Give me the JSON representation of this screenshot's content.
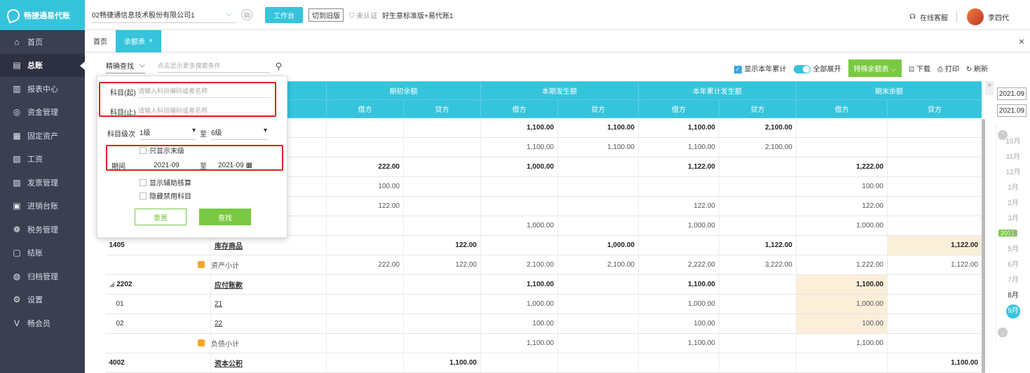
{
  "app": {
    "name": "畅捷通易代账"
  },
  "sidebar": {
    "items": [
      {
        "label": "首页",
        "icon": "home-icon",
        "glyph": "⌂"
      },
      {
        "label": "总账",
        "icon": "ledger-icon",
        "glyph": "▤",
        "active": true
      },
      {
        "label": "报表中心",
        "icon": "report-icon",
        "glyph": "▥"
      },
      {
        "label": "资金管理",
        "icon": "fund-icon",
        "glyph": "◎"
      },
      {
        "label": "固定资产",
        "icon": "asset-icon",
        "glyph": "▦"
      },
      {
        "label": "工资",
        "icon": "salary-icon",
        "glyph": "▧"
      },
      {
        "label": "发票管理",
        "icon": "invoice-icon",
        "glyph": "▨"
      },
      {
        "label": "进销台账",
        "icon": "inventory-icon",
        "glyph": "▣"
      },
      {
        "label": "税务管理",
        "icon": "tax-icon",
        "glyph": "❁"
      },
      {
        "label": "结账",
        "icon": "close-account-icon",
        "glyph": "▢"
      },
      {
        "label": "归档管理",
        "icon": "archive-icon",
        "glyph": "◍"
      },
      {
        "label": "设置",
        "icon": "settings-icon",
        "glyph": "⚙"
      },
      {
        "label": "畅会员",
        "icon": "vip-icon",
        "glyph": "V"
      }
    ]
  },
  "topbar": {
    "company": "02畅捷通信息技术股份有限公司1",
    "workbench": "工作台",
    "switch_version": "切到旧版",
    "cert": "未认证",
    "edition": "好生意标准版+易代账1",
    "service": "在线客服",
    "user": "李四代"
  },
  "tabs": [
    {
      "label": "首页"
    },
    {
      "label": "余额表",
      "active": true
    }
  ],
  "toolbar": {
    "search_mode": "精确查找",
    "search_more": "点击显示更多搜索条件",
    "show_year": "显示本年累计",
    "expand_all": "全部展开",
    "special_balance": "特殊余额表",
    "download": "下载",
    "print": "打印",
    "refresh": "刷新"
  },
  "search": {
    "from_label": "科目(起)",
    "to_label": "科目(止)",
    "placeholder": "请输入科目编码或者名称",
    "level_label": "科目级次",
    "level_from": "1级",
    "level_to_sep": "至",
    "level_to": "6级",
    "only_last": "只显示末级",
    "period_label": "期间",
    "period_from": "2021-09",
    "period_sep": "至",
    "period_to": "2021-09",
    "show_aux": "显示辅助核算",
    "hide_disabled": "隐藏禁用科目",
    "reset": "重置",
    "find": "查找"
  },
  "table": {
    "group_headers": [
      "期初余额",
      "本期发生额",
      "本年累计发生额",
      "期末余额"
    ],
    "sub_headers": [
      "借方",
      "贷方",
      "借方",
      "贷方",
      "借方",
      "贷方",
      "借方",
      "贷方"
    ],
    "rows": [
      {
        "code": "",
        "name": "",
        "bold": true,
        "vals": [
          "",
          "",
          "1,100.00",
          "1,100.00",
          "1,100.00",
          "2,100.00",
          "",
          ""
        ]
      },
      {
        "code": "",
        "name": "",
        "vals": [
          "",
          "",
          "1,100.00",
          "1,100.00",
          "1,100.00",
          "2,100.00",
          "",
          ""
        ]
      },
      {
        "code": "",
        "name": "",
        "bold": true,
        "vals": [
          "222.00",
          "",
          "1,000.00",
          "",
          "1,122.00",
          "",
          "1,222.00",
          ""
        ]
      },
      {
        "code": "",
        "name": "",
        "vals": [
          "100.00",
          "",
          "",
          "",
          "",
          "",
          "100.00",
          ""
        ]
      },
      {
        "code": "",
        "name": "",
        "vals": [
          "122.00",
          "",
          "",
          "",
          "122.00",
          "",
          "122.00",
          ""
        ]
      },
      {
        "code": "",
        "name": "",
        "vals": [
          "",
          "",
          "1,000.00",
          "",
          "1,000.00",
          "",
          "1,000.00",
          ""
        ]
      },
      {
        "code": "1405",
        "name": "库存商品",
        "bold": true,
        "vals": [
          "",
          "122.00",
          "",
          "1,000.00",
          "",
          "1,122.00",
          "",
          "1,122.00"
        ],
        "hl": [
          7
        ]
      },
      {
        "code": "",
        "name": "资产小计",
        "subtotal": true,
        "vals": [
          "222.00",
          "122.00",
          "2,100.00",
          "2,100.00",
          "2,222.00",
          "3,222.00",
          "1,222.00",
          "1,122.00"
        ]
      },
      {
        "code": "2202",
        "name": "应付账款",
        "bold": true,
        "expand": true,
        "vals": [
          "",
          "",
          "1,100.00",
          "",
          "1,100.00",
          "",
          "1,100.00",
          ""
        ],
        "hl": [
          6
        ]
      },
      {
        "code": "01",
        "name": "21",
        "link": true,
        "vals": [
          "",
          "",
          "1,000.00",
          "",
          "1,000.00",
          "",
          "1,000.00",
          ""
        ],
        "hl": [
          6
        ]
      },
      {
        "code": "02",
        "name": "22",
        "link": true,
        "vals": [
          "",
          "",
          "100.00",
          "",
          "100.00",
          "",
          "100.00",
          ""
        ],
        "hl": [
          6
        ]
      },
      {
        "code": "",
        "name": "负债小计",
        "subtotal": true,
        "vals": [
          "",
          "",
          "1,100.00",
          "",
          "1,100.00",
          "",
          "1,100.00",
          ""
        ]
      },
      {
        "code": "4002",
        "name": "资本公积",
        "bold": true,
        "vals": [
          "",
          "1,100.00",
          "",
          "",
          "",
          "",
          "",
          "1,100.00"
        ]
      }
    ]
  },
  "period_panel": {
    "start": "2021.09",
    "end": "2021.09",
    "year_tag": "2021",
    "months": [
      "10月",
      "11月",
      "12月",
      "1月",
      "2月",
      "3月",
      "4月",
      "5月",
      "6月",
      "7月",
      "8月",
      "9月"
    ],
    "current": "9月"
  }
}
